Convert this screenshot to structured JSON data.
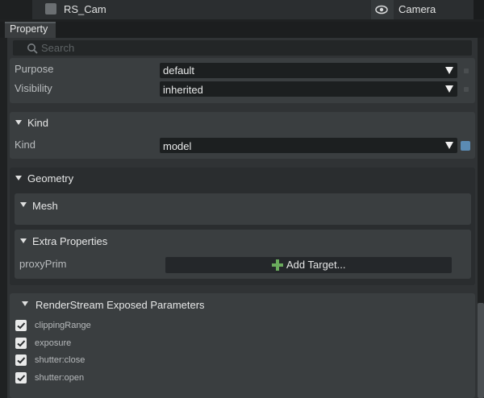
{
  "stage": {
    "prim_name": "RS_Cam",
    "prim_type": "Camera"
  },
  "tabs": [
    {
      "label": "Property"
    }
  ],
  "search": {
    "placeholder": "Search"
  },
  "prim_section": {
    "purpose_label": "Purpose",
    "purpose_value": "default",
    "visibility_label": "Visibility",
    "visibility_value": "inherited"
  },
  "kind_section": {
    "header": "Kind",
    "kind_label": "Kind",
    "kind_value": "model",
    "accent_color": "#5b8bb4"
  },
  "geometry_section": {
    "header": "Geometry",
    "mesh_header": "Mesh",
    "extra_header": "Extra Properties",
    "proxy_label": "proxyPrim",
    "add_target_label": "Add Target..."
  },
  "renderstream_section": {
    "header": "RenderStream Exposed Parameters",
    "params": [
      {
        "label": "clippingRange",
        "checked": true
      },
      {
        "label": "exposure",
        "checked": true
      },
      {
        "label": "shutter:close",
        "checked": true
      },
      {
        "label": "shutter:open",
        "checked": true
      }
    ]
  },
  "icons": {
    "visibility": "eye-icon",
    "search": "search-icon",
    "add": "plus-icon"
  }
}
